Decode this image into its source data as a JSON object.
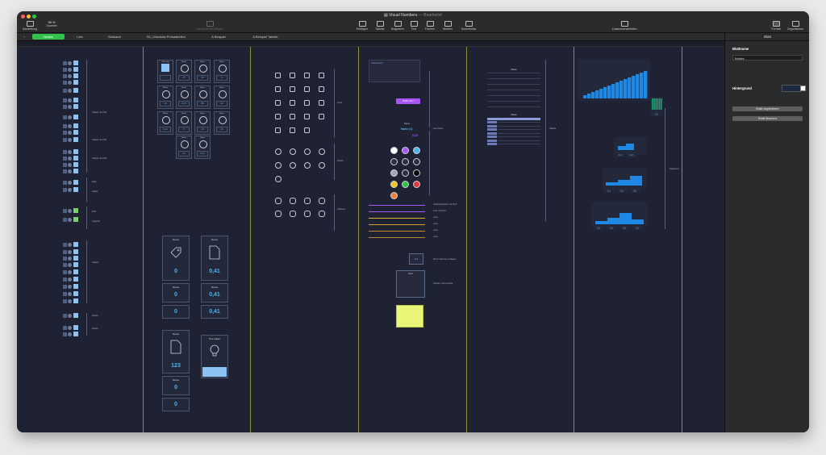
{
  "window": {
    "title": "Visual Numbers",
    "subtitle": "— Bearbeitet"
  },
  "toolbar": {
    "left": [
      {
        "label": "Darstellung",
        "icon": "sidebar-icon"
      },
      {
        "label": "Zoomen",
        "icon": "zoom-icon",
        "value": "95 %"
      }
    ],
    "center_disabled": {
      "label": "Kategorie hinzufügen",
      "icon": "add-category-icon"
    },
    "center": [
      {
        "label": "Einfügen",
        "icon": "insert-icon"
      },
      {
        "label": "Tabelle",
        "icon": "table-icon"
      },
      {
        "label": "Diagramm",
        "icon": "chart-icon"
      },
      {
        "label": "Text",
        "icon": "text-icon"
      },
      {
        "label": "Formen",
        "icon": "shapes-icon"
      },
      {
        "label": "Medien",
        "icon": "media-icon"
      },
      {
        "label": "Kommentar",
        "icon": "comment-icon"
      }
    ],
    "collaborate": {
      "label": "Zusammenarbeiten",
      "icon": "collaborate-icon"
    },
    "right": [
      {
        "label": "Format",
        "icon": "format-brush-icon"
      },
      {
        "label": "Organisieren",
        "icon": "organize-icon"
      }
    ]
  },
  "tabs": {
    "add": "+",
    "items": [
      "Nodes",
      "Lien",
      "Bildband",
      "B1 | Mandala Preistabellen",
      "A Beispiel",
      "A Beispiel Tabelle"
    ],
    "active_index": 0
  },
  "canvas": {
    "column1": {
      "labels": [
        "Tabelle mit Pfeil",
        "Tabelle mit Pfeil",
        "Tabelle mit Pfeil",
        "Zeile",
        "Spalte",
        "Pfeil",
        "Legende",
        "Tabelle",
        "Zahlen",
        "Zahlen"
      ]
    },
    "column2": {
      "small_cards": [
        {
          "name": "Warnung",
          "value": ""
        },
        {
          "name": "Name",
          "value": "15"
        },
        {
          "name": "Name",
          "value": "33"
        },
        {
          "name": "Name",
          "value": "0"
        },
        {
          "name": "Name",
          "value": "15"
        },
        {
          "name": "Name",
          "value": "0,41"
        },
        {
          "name": "Name",
          "value": "88"
        },
        {
          "name": "Name",
          "value": "22"
        },
        {
          "name": "Name",
          "value": "0,41"
        },
        {
          "name": "Name",
          "value": "5"
        },
        {
          "name": "Name",
          "value": "15"
        },
        {
          "name": "Name",
          "value": "15"
        },
        {
          "name": "Name",
          "value": "22"
        },
        {
          "name": "Name",
          "value": "0,41"
        }
      ],
      "big_cards": [
        {
          "name": "Name",
          "value": "0",
          "icon": "tag-icon"
        },
        {
          "name": "Name",
          "value": "0,41",
          "icon": "document-icon"
        },
        {
          "name": "Name",
          "value": "0"
        },
        {
          "name": "Name",
          "value": "0,41"
        },
        {
          "name": "",
          "value": "0"
        },
        {
          "name": "",
          "value": "0,41"
        },
        {
          "name": "Name",
          "value": "123",
          "icon": "document-icon"
        },
        {
          "name": "True False",
          "value": "",
          "icon": "lightbulb-icon"
        },
        {
          "name": "Name",
          "value": "0"
        },
        {
          "name": "",
          "value": "0"
        }
      ]
    },
    "column3": {
      "group_labels": [
        "Icons",
        "Zahlen",
        "Aktionen"
      ]
    },
    "column4": {
      "header_label": "Tabellenkopf",
      "button_label": "Button Text",
      "value_title": "Name",
      "value_a": "Name (1)",
      "value_b": "0,15",
      "side_label": "Icon Farbe",
      "color_dots": [
        "#ffffff",
        "#a855f7",
        "#4fb2ee",
        "#2b2f3f",
        "#2b2f3f",
        "#2b2f3f",
        "#a0a6b4",
        "#2b2f3f",
        "#000000",
        "#f5c518",
        "#30c24a",
        "#e53935",
        "#f08030"
      ],
      "line_labels": [
        "Verbindungslinie mit Pfeil",
        "Linie mit Pfeil",
        "Linie",
        "Linie",
        "Linie",
        "Linie"
      ],
      "box_value": "0,1",
      "box_label": "Wert / Nummer einfügen",
      "note_title": "Notiz",
      "note_label": "Notizen / Kommentar"
    },
    "column5": {
      "table_title": "Tabelle",
      "table_title_2": "Tabelle",
      "side_label": "Tabelle"
    },
    "column6": {
      "bar_chart_steps": [
        2,
        3,
        4,
        5,
        6,
        7,
        8,
        9,
        10,
        11,
        12,
        13,
        14,
        15,
        16,
        17
      ],
      "small_values": [
        "0,1"
      ],
      "group1_values": [
        "0,1",
        "0,2"
      ],
      "group2_values": [
        "0,1",
        "0,2",
        "0,5"
      ],
      "group3_values": [
        "0,1",
        "0,2",
        "0,5",
        "0,1"
      ],
      "side_label": "Diagramm"
    }
  },
  "sidebar": {
    "header": "Blatt",
    "name_label": "Blattname",
    "name_value": "Nodes",
    "background_label": "Hintergrund",
    "duplicate_button": "Blatt duplizieren",
    "delete_button": "Blatt löschen",
    "background_color": "#ffffff"
  }
}
